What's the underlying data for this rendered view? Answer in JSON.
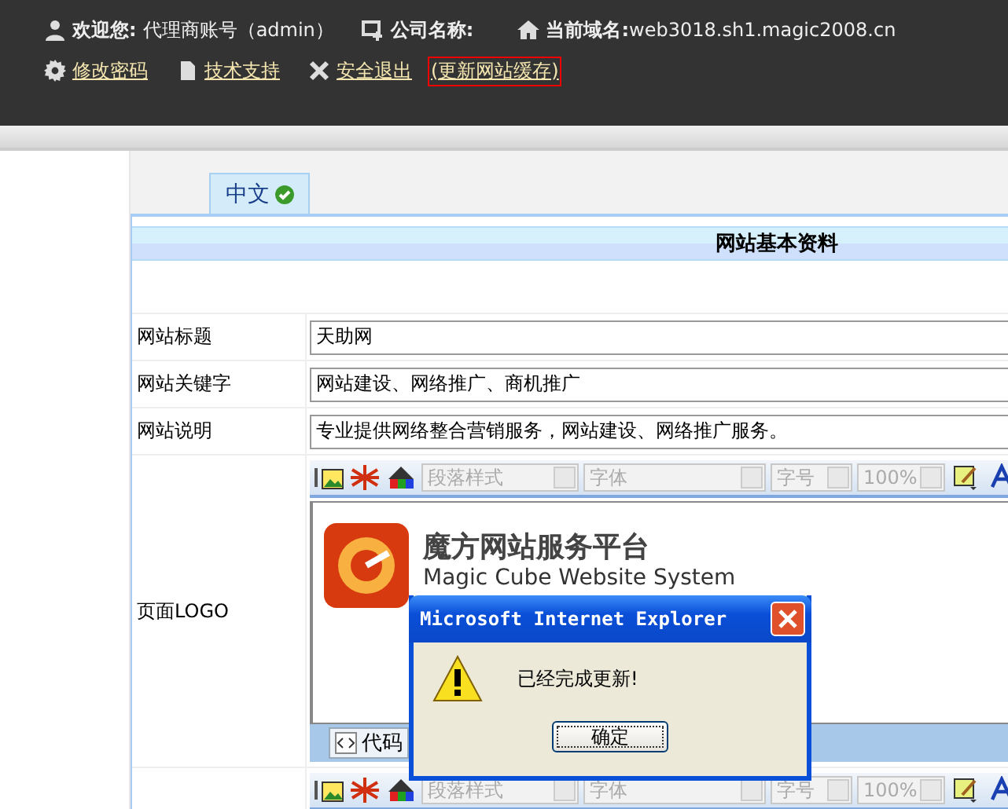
{
  "header": {
    "welcome_label": "欢迎您:",
    "account": "代理商账号（admin）",
    "company_label": "公司名称:",
    "domain_label": "当前域名:",
    "domain": "web3018.sh1.magic2008.cn"
  },
  "links": [
    {
      "label": "修改密码",
      "highlighted": false
    },
    {
      "label": "技术支持",
      "highlighted": false
    },
    {
      "label": "安全退出",
      "highlighted": false
    },
    {
      "label": "(更新网站缓存)",
      "highlighted": true
    }
  ],
  "tabs": [
    {
      "label": "中文",
      "selected": true
    }
  ],
  "panel": {
    "title": "网站基本资料",
    "fields": [
      {
        "label": "网站标题",
        "value": "天助网"
      },
      {
        "label": "网站关键字",
        "value": "网站建设、网络推广、商机推广"
      },
      {
        "label": "网站说明",
        "value": "专业提供网络整合营销服务，网站建设、网络推广服务。"
      }
    ],
    "editor": {
      "label": "页面LOGO",
      "dropdowns": [
        "段落样式",
        "字体",
        "字号",
        "100%"
      ],
      "logo_title": "魔方网站服务平台",
      "logo_subtitle": "Magic Cube Website System",
      "code_button": "代码"
    },
    "next_editor": {
      "dropdowns": [
        "段落样式",
        "字体",
        "字号",
        "100%"
      ]
    }
  },
  "dialog": {
    "title": "Microsoft Internet Explorer",
    "message": "已经完成更新!",
    "button": "确定"
  }
}
